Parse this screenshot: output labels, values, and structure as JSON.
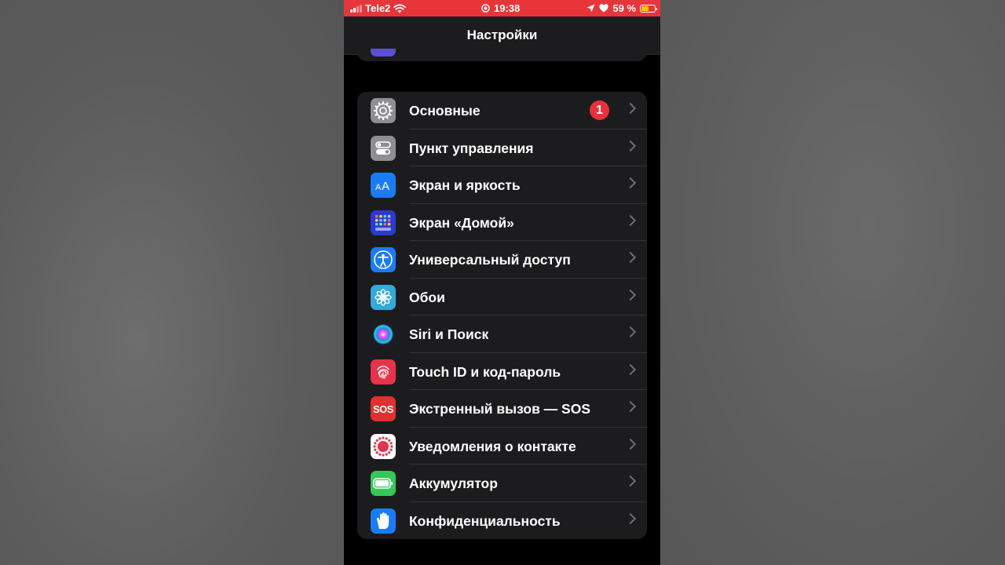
{
  "status_bar": {
    "carrier": "Tele2",
    "time": "19:38",
    "battery_percent": "59 %",
    "battery_level": 0.59,
    "color": "#e8353a"
  },
  "nav": {
    "title": "Настройки"
  },
  "settings": [
    {
      "label": "Основные",
      "icon": "gear-icon",
      "color": "#8e8e93",
      "badge": "1"
    },
    {
      "label": "Пункт управления",
      "icon": "toggles-icon",
      "color": "#8e8e93"
    },
    {
      "label": "Экран и яркость",
      "icon": "text-size-icon",
      "color": "#1a7cf5"
    },
    {
      "label": "Экран «Домой»",
      "icon": "home-grid-icon",
      "color": "#2a3ad1"
    },
    {
      "label": "Универсальный доступ",
      "icon": "accessibility-icon",
      "color": "#1a7cf5"
    },
    {
      "label": "Обои",
      "icon": "flower-icon",
      "color": "#35a9d8"
    },
    {
      "label": "Siri и Поиск",
      "icon": "siri-icon",
      "color": "#1b1b2e"
    },
    {
      "label": "Touch ID и код-пароль",
      "icon": "fingerprint-icon",
      "color": "#e5334b"
    },
    {
      "label": "Экстренный вызов — SOS",
      "icon": "sos-icon",
      "color": "#e0302f",
      "icon_text": "SOS"
    },
    {
      "label": "Уведомления о контакте",
      "icon": "exposure-icon",
      "color": "#ffffff"
    },
    {
      "label": "Аккумулятор",
      "icon": "battery-icon",
      "color": "#34c759"
    },
    {
      "label": "Конфиденциальность",
      "icon": "hand-icon",
      "color": "#1a7cf5"
    }
  ]
}
